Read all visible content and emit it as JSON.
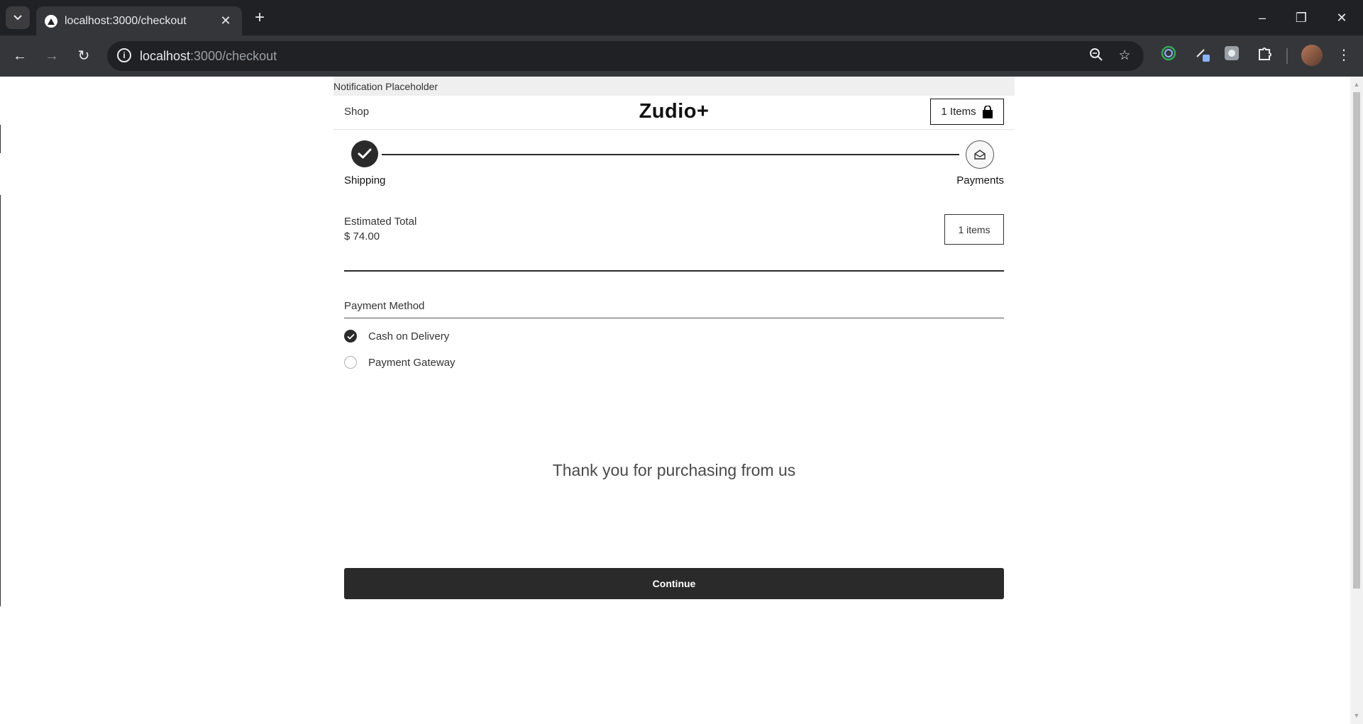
{
  "browser": {
    "tab_title": "localhost:3000/checkout",
    "url_host": "localhost",
    "url_path": ":3000/checkout",
    "window_controls": {
      "minimize": "–",
      "restore": "❐",
      "close": "✕"
    }
  },
  "page": {
    "notification": "Notification Placeholder",
    "nav": {
      "shop_label": "Shop",
      "brand": "Zudio+",
      "cart_label": "1 Items"
    },
    "steps": [
      {
        "label": "Shipping",
        "state": "complete"
      },
      {
        "label": "Payments",
        "state": "pending"
      }
    ],
    "summary": {
      "estimated_label": "Estimated Total",
      "estimated_value": "$ 74.00",
      "items_label": "1 items"
    },
    "payment": {
      "title": "Payment Method",
      "options": [
        {
          "label": "Cash on Delivery",
          "selected": true
        },
        {
          "label": "Payment Gateway",
          "selected": false
        }
      ]
    },
    "thank_you": "Thank you for purchasing from us",
    "continue_label": "Continue"
  },
  "colors": {
    "chrome_dark": "#202124",
    "chrome_toolbar": "#35363a",
    "accent_dark": "#2a2a2a"
  }
}
